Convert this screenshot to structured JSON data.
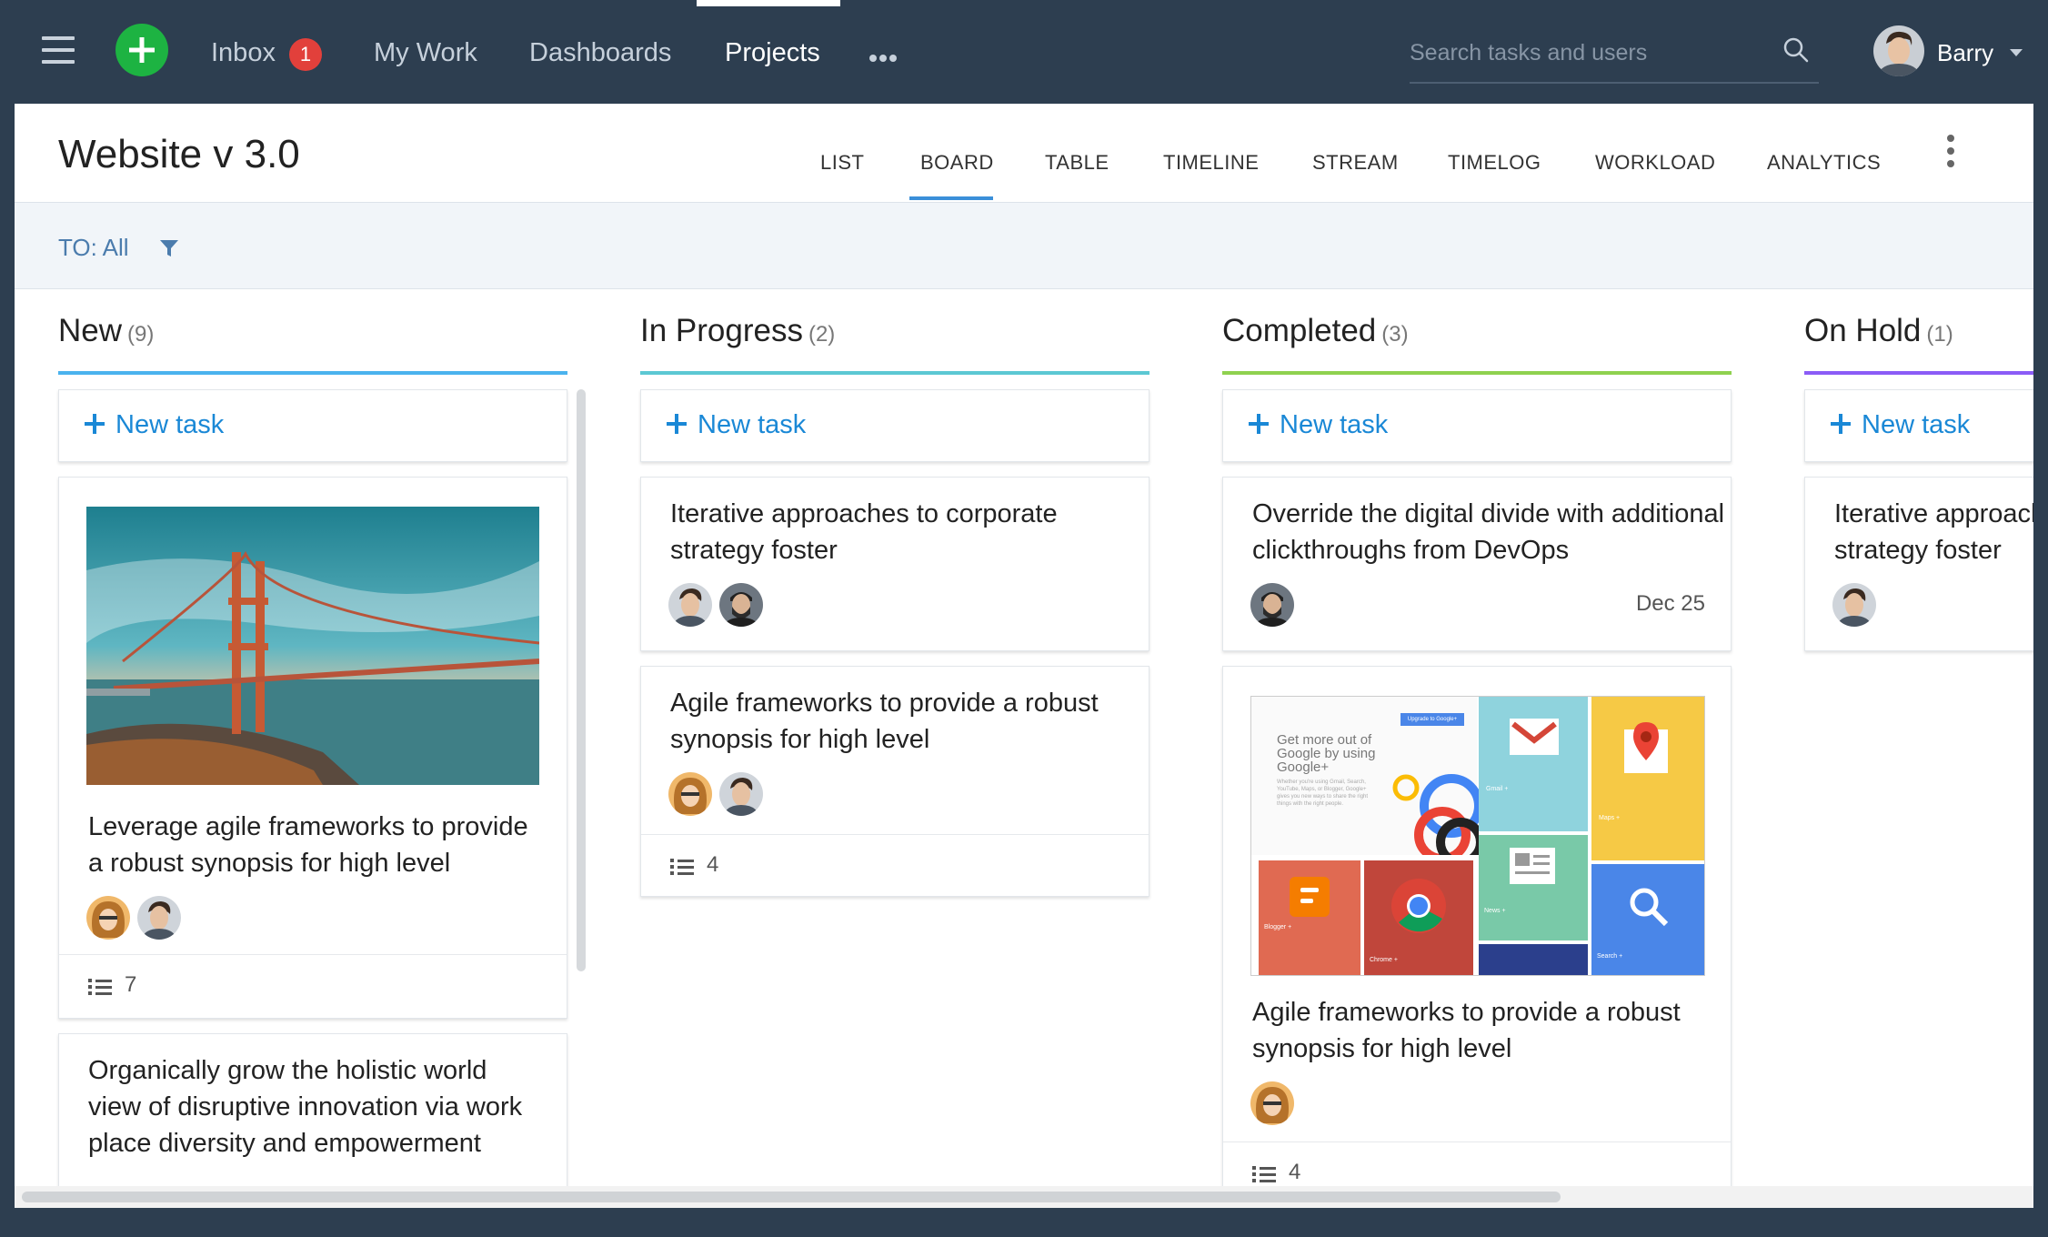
{
  "topnav": {
    "inbox_label": "Inbox",
    "inbox_badge": "1",
    "my_work_label": "My Work",
    "dashboards_label": "Dashboards",
    "projects_label": "Projects",
    "search_placeholder": "Search tasks and users",
    "user_name": "Barry"
  },
  "project": {
    "title": "Website v 3.0",
    "tabs": [
      "LIST",
      "BOARD",
      "TABLE",
      "TIMELINE",
      "STREAM",
      "TIMELOG",
      "WORKLOAD",
      "ANALYTICS"
    ],
    "active_tab": "BOARD"
  },
  "filter": {
    "label": "TO: All"
  },
  "colors": {
    "new": "#4ab3ee",
    "in_progress": "#5cc8d3",
    "completed": "#8fd14f",
    "on_hold": "#8b5cf6",
    "accent": "#1a88d6",
    "badge": "#e2403b",
    "add_button": "#1db342"
  },
  "columns": [
    {
      "name": "New",
      "count": "(9)",
      "new_task_label": "New task",
      "cards": [
        {
          "title": "Leverage agile frameworks to provide a robust synopsis for high level",
          "image": "golden-gate-bridge",
          "subtasks": "7"
        },
        {
          "title": "Organically grow the holistic world view of disruptive innovation via work place diversity and empowerment"
        }
      ]
    },
    {
      "name": "In Progress",
      "count": "(2)",
      "new_task_label": "New task",
      "cards": [
        {
          "title": "Iterative approaches to corporate strategy foster"
        },
        {
          "title": "Agile frameworks to provide a robust synopsis for high level",
          "subtasks": "4"
        }
      ]
    },
    {
      "name": "Completed",
      "count": "(3)",
      "new_task_label": "New task",
      "cards": [
        {
          "title": "Override the digital divide with additional clickthroughs from DevOps",
          "due": "Dec 25"
        },
        {
          "title": "Agile frameworks to provide a robust synopsis for high level",
          "image": "google-plus-promo",
          "subtasks": "4"
        }
      ]
    },
    {
      "name": "On Hold",
      "count": "(1)",
      "new_task_label": "New task",
      "cards": [
        {
          "title": "Iterative approaches to corporate strategy foster"
        }
      ]
    }
  ],
  "promo_image_text": {
    "headline": "Get more out of Google by using Google+",
    "upgrade": "Upgrade to Google+",
    "body": "Whether you're using Gmail, Search, YouTube, Maps, or Blogger, Google+ gives you new ways to share the right things with the right people.",
    "tiles": [
      "Gmail +",
      "Maps +",
      "Blogger +",
      "Chrome +",
      "News +",
      "Search +"
    ]
  }
}
